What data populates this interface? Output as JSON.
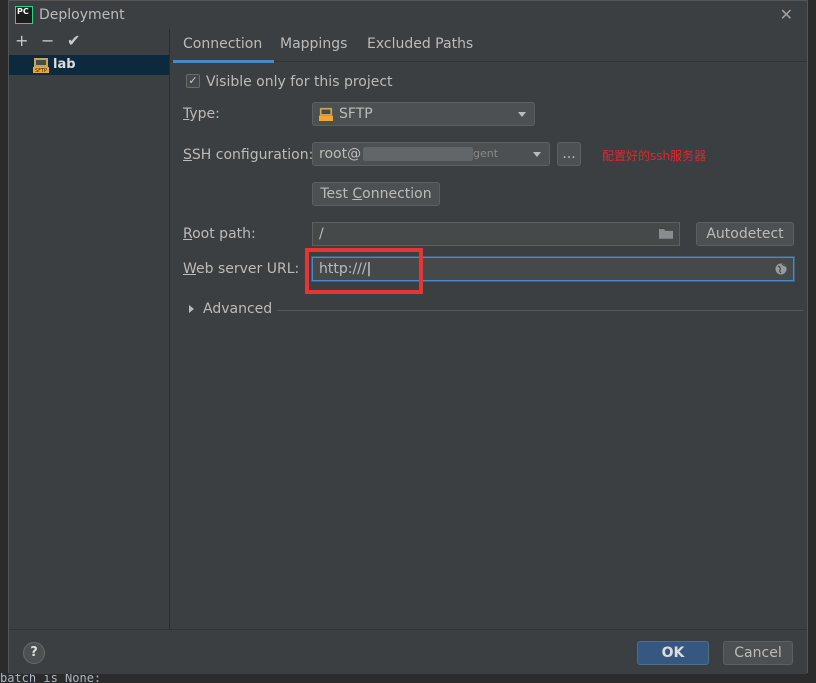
{
  "window": {
    "title": "Deployment",
    "app_icon_text": "PC"
  },
  "toolbar": {
    "add": "+",
    "remove": "−",
    "apply": "✔"
  },
  "servers": [
    {
      "label": "lab",
      "icon": "sftp-icon"
    }
  ],
  "tabs": [
    {
      "label": "Connection",
      "active": true
    },
    {
      "label": "Mappings",
      "active": false
    },
    {
      "label": "Excluded Paths",
      "active": false
    }
  ],
  "form": {
    "visible_only_label": "Visible only for this project",
    "visible_only_checked": true,
    "type_label": "Type:",
    "type_value": "SFTP",
    "ssh_label": "SSH configuration:",
    "ssh_value_prefix": "root@",
    "ssh_value_suffix": "gent",
    "ssh_browse": "...",
    "annotation": "配置好的ssh服务器",
    "test_connection": "Test Connection",
    "root_path_label": "Root path:",
    "root_path_value": "/",
    "autodetect": "Autodetect",
    "web_url_label": "Web server URL:",
    "web_url_value": "http:///",
    "advanced_label": "Advanced"
  },
  "footer": {
    "help": "?",
    "ok": "OK",
    "cancel": "Cancel"
  },
  "background_code": "batch is None:",
  "colors": {
    "accent": "#4a88c7",
    "selection": "#0d293e",
    "annotation": "#e0262c",
    "ok_button": "#365880"
  }
}
